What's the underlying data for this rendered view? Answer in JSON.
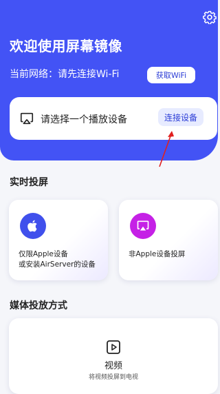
{
  "header": {
    "title": "欢迎使用屏幕镜像",
    "network_text": "当前网络：请先连接Wi-Fi",
    "get_wifi_label": "获取WiFi",
    "settings_icon": "gear-icon"
  },
  "device": {
    "label": "请选择一个播放设备",
    "connect_label": "连接设备",
    "cast_icon": "airplay-icon"
  },
  "realtime": {
    "title": "实时投屏",
    "cards": [
      {
        "text_line1": "仅限Apple设备",
        "text_line2": "或安装AirServer的设备",
        "icon": "apple-icon",
        "color": "#4050ec"
      },
      {
        "text_line1": "非Apple设备投屏",
        "text_line2": "",
        "icon": "airplay-icon",
        "color": "#c521e6"
      }
    ]
  },
  "media": {
    "title": "媒体投放方式",
    "video_title": "视频",
    "video_subtitle": "将视频投屏到电视",
    "video_icon": "play-icon"
  },
  "colors": {
    "header_bg": "#4353f5",
    "accent": "#2b3cd6",
    "arrow": "#e02020"
  }
}
